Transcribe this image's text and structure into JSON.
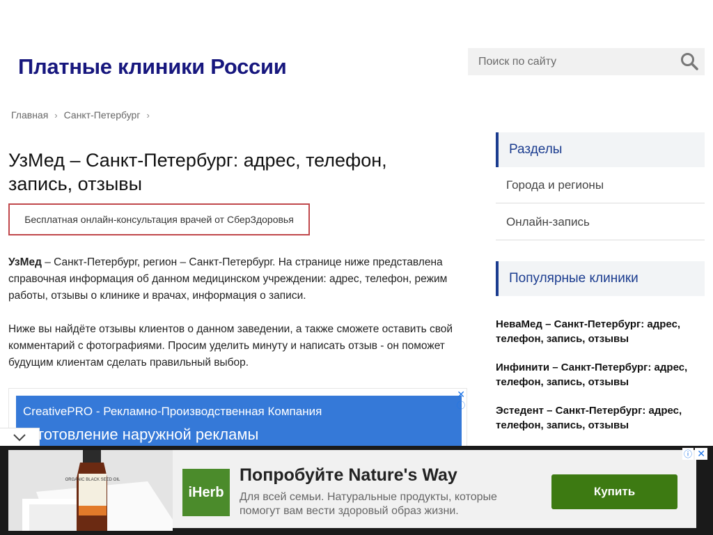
{
  "header": {
    "site_title": "Платные клиники России",
    "search_placeholder": "Поиск по сайту"
  },
  "breadcrumb": {
    "items": [
      "Главная",
      "Санкт-Петербург"
    ],
    "separator": "›"
  },
  "main": {
    "title": "УзМед – Санкт-Петербург: адрес, телефон, запись, отзывы",
    "consult_banner": "Бесплатная онлайн-консультация врачей от СберЗдоровья",
    "intro_bold": "УзМед",
    "intro_rest": " – Санкт-Петербург, регион – Санкт-Петербург. На странице ниже представлена справочная информация об данном медицинском учреждении: адрес, телефон, режим работы, отзывы о клинике и врачах, информация о записи.",
    "paragraph2": "Ниже вы найдёте отзывы клиентов о данном заведении, а также сможете оставить свой комментарий с фотографиями. Просим уделить минуту и написать отзыв - он поможет будущим клиентам сделать правильный выбор."
  },
  "inline_ad": {
    "title": "CreativePRO - Рекламно-Производственная Компания",
    "subtitle": "изготовление наружной рекламы",
    "color": "#3579d8"
  },
  "sidebar": {
    "sections_heading": "Разделы",
    "sections": [
      "Города и регионы",
      "Онлайн-запись"
    ],
    "popular_heading": "Популярные клиники",
    "clinics": [
      "НеваМед – Санкт-Петербург: адрес, телефон, запись, отзывы",
      "Инфинити – Санкт-Петербург: адрес, телефон, запись, отзывы",
      "Эстедент – Санкт-Петербург: адрес, телефон, запись, отзывы"
    ],
    "accent_color": "#1b3c8f"
  },
  "bottom_ad": {
    "logo_text": "iHerb",
    "product_label": "ORGANIC BLACK SEED OIL",
    "title": "Попробуйте Nature's Way",
    "description": "Для всей семьи. Натуральные продукты, которые помогут вам вести здоровый образ жизни.",
    "button_label": "Купить",
    "button_color": "#3d7a12"
  },
  "icons": {
    "search": "search-icon",
    "collapse": "chevron-down-icon",
    "close": "close-icon",
    "info": "info-icon"
  }
}
